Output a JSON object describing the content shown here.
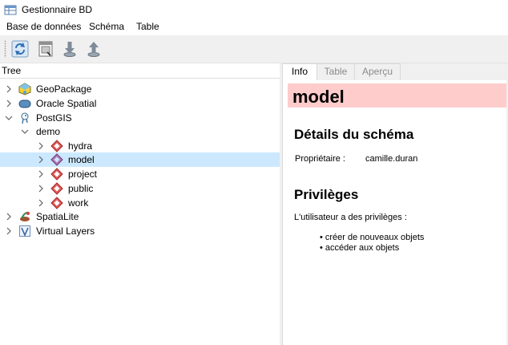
{
  "window": {
    "title": "Gestionnaire BD"
  },
  "menu": [
    "Base de données",
    "Schéma",
    "Table"
  ],
  "toolbar": {
    "buttons": [
      "refresh-icon",
      "sql-window-icon",
      "import-layer-icon",
      "export-icon"
    ]
  },
  "tree": {
    "header": "Tree",
    "items": [
      {
        "label": "GeoPackage",
        "icon": "geopackage-icon",
        "expanded": false
      },
      {
        "label": "Oracle Spatial",
        "icon": "oracle-icon",
        "expanded": false
      },
      {
        "label": "PostGIS",
        "icon": "postgis-icon",
        "expanded": true
      },
      {
        "label": "demo",
        "icon": "",
        "expanded": true
      },
      {
        "label": "hydra",
        "icon": "schema-icon",
        "expanded": false
      },
      {
        "label": "model",
        "icon": "schema-icon",
        "expanded": false,
        "selected": true
      },
      {
        "label": "project",
        "icon": "schema-icon",
        "expanded": false
      },
      {
        "label": "public",
        "icon": "schema-icon",
        "expanded": false
      },
      {
        "label": "work",
        "icon": "schema-icon",
        "expanded": false
      },
      {
        "label": "SpatiaLite",
        "icon": "spatialite-icon",
        "expanded": false
      },
      {
        "label": "Virtual Layers",
        "icon": "virtual-layers-icon",
        "expanded": false
      }
    ]
  },
  "tabs": [
    {
      "label": "Info",
      "active": true
    },
    {
      "label": "Table",
      "active": false
    },
    {
      "label": "Aperçu",
      "active": false
    }
  ],
  "info": {
    "title": "model",
    "title_bg": "#ffcccc",
    "schema_details_heading": "Détails du schéma",
    "owner_label": "Propriétaire :",
    "owner_value": "camille.duran",
    "privileges_heading": "Privilèges",
    "privileges_text": "L'utilisateur a des privilèges :",
    "privileges": [
      "créer de nouveaux objets",
      "accéder aux objets"
    ]
  },
  "colors": {
    "selection": "#cce8ff",
    "schema_icon": "#e05050"
  }
}
